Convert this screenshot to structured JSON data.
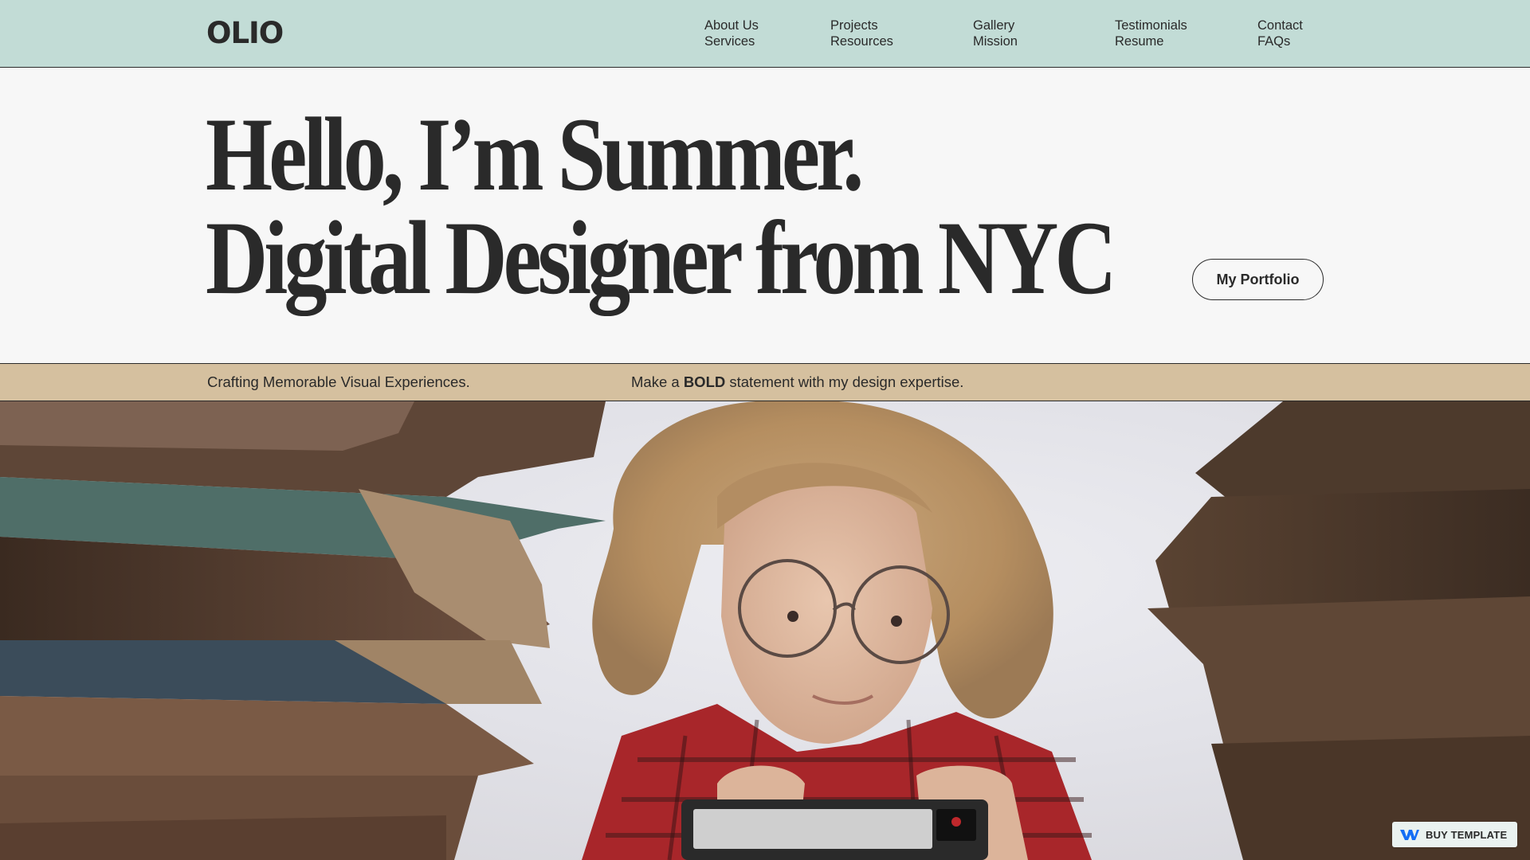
{
  "brand": {
    "logo_text": "OLIO"
  },
  "nav": {
    "columns": [
      {
        "top": "About Us",
        "bottom": "Services"
      },
      {
        "top": "Projects",
        "bottom": "Resources"
      },
      {
        "top": "Gallery",
        "bottom": "Mission"
      },
      {
        "top": "Testimonials",
        "bottom": "Resume"
      },
      {
        "top": "Contact",
        "bottom": "FAQs"
      }
    ]
  },
  "hero": {
    "headline_line1": "Hello, I’m Summer.",
    "headline_line2": "Digital Designer from NYC",
    "portfolio_button": "My Portfolio"
  },
  "strip": {
    "left_text": "Crafting Memorable Visual Experiences.",
    "right_prefix": "Make a ",
    "right_bold": "BOLD",
    "right_suffix": " statement with my design expertise."
  },
  "photo": {
    "subject": "person-with-camera-photo",
    "icon": "photo-image"
  },
  "badge": {
    "label": "BUY TEMPLATE",
    "icon": "webflow-logo-icon"
  },
  "colors": {
    "nav_bg": "#c2dcd6",
    "hero_bg": "#f7f7f7",
    "strip_bg": "#d5c09f",
    "text": "#2a2a2a",
    "badge_icon": "#146ef5"
  }
}
